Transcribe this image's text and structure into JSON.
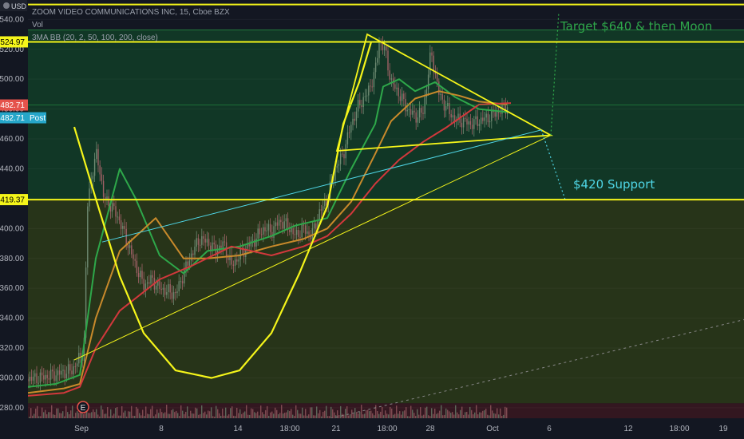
{
  "legend": {
    "symbol": "ZOOM VIDEO COMMUNICATIONS INC, 15, Cboe BZX",
    "volume": "Vol",
    "indicator": "3MA BB (20, 2, 50, 100, 200, close)"
  },
  "axis": {
    "currency": "USD",
    "price_badges": [
      {
        "value": "524.97",
        "color": "#f5f51a"
      },
      {
        "value": "482.71",
        "color": "#e5534b"
      },
      {
        "value": "419.37",
        "color": "#f5f51a"
      }
    ],
    "post_badge": {
      "value": "482.71",
      "label": "Post",
      "color": "#26a6c9"
    }
  },
  "annotations": {
    "target": "Target $640 & then Moon",
    "support": "$420 Support",
    "event_marker": "E"
  },
  "colors": {
    "background": "#131722",
    "upper_zone": "#123d27",
    "lower_zone": "#2c3a18",
    "volume_zone": "#3a1720",
    "yellow": "#f5f51a",
    "cyan": "#4fd6e6",
    "ma_green": "#2ea84a",
    "ma_orange": "#c98a2b",
    "ma_red": "#d2383c",
    "candle_up": "#6e8a72",
    "candle_down": "#a06166",
    "target_text": "#2ea84a",
    "support_text": "#4fd6e6"
  },
  "chart_data": {
    "type": "candlestick",
    "y_ticks": [
      280,
      300,
      320,
      340,
      360,
      380,
      400,
      420,
      440,
      460,
      480,
      500,
      520,
      540
    ],
    "ylim": [
      273,
      553
    ],
    "x_ticks": [
      "Sep",
      "8",
      "14",
      "18:00",
      "21",
      "18:00",
      "28",
      "Oct",
      "6",
      "12",
      "18:00",
      "19"
    ],
    "horizontal_levels": [
      550,
      533,
      524.97,
      482.71,
      419.37
    ],
    "zones": [
      {
        "name": "upper",
        "from": 419.37,
        "to": 533
      },
      {
        "name": "lower",
        "from": 283,
        "to": 419.37
      },
      {
        "name": "volume",
        "from": 273,
        "to": 283
      }
    ],
    "price_path": [
      [
        0,
        298
      ],
      [
        50,
        300
      ],
      [
        90,
        305
      ],
      [
        105,
        318
      ],
      [
        110,
        420
      ],
      [
        120,
        450
      ],
      [
        125,
        440
      ],
      [
        130,
        420
      ],
      [
        140,
        415
      ],
      [
        150,
        405
      ],
      [
        160,
        390
      ],
      [
        170,
        375
      ],
      [
        180,
        362
      ],
      [
        190,
        366
      ],
      [
        200,
        360
      ],
      [
        210,
        358
      ],
      [
        220,
        356
      ],
      [
        230,
        370
      ],
      [
        240,
        383
      ],
      [
        250,
        393
      ],
      [
        260,
        391
      ],
      [
        270,
        385
      ],
      [
        280,
        390
      ],
      [
        290,
        375
      ],
      [
        300,
        382
      ],
      [
        310,
        388
      ],
      [
        320,
        393
      ],
      [
        330,
        400
      ],
      [
        340,
        398
      ],
      [
        350,
        405
      ],
      [
        360,
        402
      ],
      [
        370,
        395
      ],
      [
        380,
        400
      ],
      [
        390,
        395
      ],
      [
        400,
        410
      ],
      [
        410,
        420
      ],
      [
        420,
        440
      ],
      [
        430,
        450
      ],
      [
        440,
        470
      ],
      [
        450,
        483
      ],
      [
        460,
        490
      ],
      [
        470,
        505
      ],
      [
        475,
        525
      ],
      [
        482,
        520
      ],
      [
        490,
        498
      ],
      [
        500,
        490
      ],
      [
        510,
        480
      ],
      [
        520,
        475
      ],
      [
        530,
        478
      ],
      [
        540,
        518
      ],
      [
        550,
        490
      ],
      [
        560,
        480
      ],
      [
        570,
        473
      ],
      [
        580,
        472
      ],
      [
        590,
        470
      ],
      [
        600,
        472
      ],
      [
        610,
        474
      ],
      [
        620,
        477
      ],
      [
        630,
        480
      ],
      [
        637,
        482.7
      ]
    ],
    "ma_series": [
      {
        "color_key": "ma_green",
        "points": [
          [
            35,
            294
          ],
          [
            70,
            296
          ],
          [
            100,
            302
          ],
          [
            120,
            380
          ],
          [
            150,
            440
          ],
          [
            170,
            420
          ],
          [
            200,
            382
          ],
          [
            230,
            370
          ],
          [
            260,
            385
          ],
          [
            300,
            388
          ],
          [
            340,
            395
          ],
          [
            370,
            402
          ],
          [
            410,
            407
          ],
          [
            440,
            440
          ],
          [
            470,
            470
          ],
          [
            480,
            495
          ],
          [
            500,
            500
          ],
          [
            520,
            492
          ],
          [
            545,
            498
          ],
          [
            570,
            488
          ],
          [
            600,
            480
          ],
          [
            635,
            478
          ]
        ]
      },
      {
        "color_key": "ma_orange",
        "points": [
          [
            35,
            290
          ],
          [
            80,
            293
          ],
          [
            100,
            296
          ],
          [
            120,
            340
          ],
          [
            150,
            385
          ],
          [
            195,
            407
          ],
          [
            230,
            380
          ],
          [
            260,
            380
          ],
          [
            300,
            382
          ],
          [
            340,
            388
          ],
          [
            380,
            393
          ],
          [
            410,
            400
          ],
          [
            440,
            418
          ],
          [
            470,
            450
          ],
          [
            490,
            472
          ],
          [
            520,
            487
          ],
          [
            550,
            492
          ],
          [
            575,
            489
          ],
          [
            600,
            485
          ],
          [
            635,
            483
          ]
        ]
      },
      {
        "color_key": "ma_red",
        "points": [
          [
            35,
            288
          ],
          [
            80,
            290
          ],
          [
            100,
            294
          ],
          [
            120,
            320
          ],
          [
            150,
            345
          ],
          [
            200,
            366
          ],
          [
            240,
            375
          ],
          [
            290,
            388
          ],
          [
            340,
            382
          ],
          [
            380,
            388
          ],
          [
            410,
            395
          ],
          [
            440,
            410
          ],
          [
            470,
            430
          ],
          [
            500,
            446
          ],
          [
            530,
            458
          ],
          [
            560,
            468
          ],
          [
            600,
            483
          ],
          [
            640,
            484
          ]
        ]
      }
    ],
    "drawings": {
      "cup_curve": [
        [
          93,
          468
        ],
        [
          120,
          420
        ],
        [
          150,
          368
        ],
        [
          180,
          330
        ],
        [
          220,
          305
        ],
        [
          265,
          300
        ],
        [
          300,
          305
        ],
        [
          340,
          330
        ],
        [
          375,
          370
        ],
        [
          410,
          415
        ],
        [
          430,
          470
        ],
        [
          450,
          498
        ],
        [
          465,
          525
        ]
      ],
      "triangle": [
        [
          422,
          452
        ],
        [
          690,
          462.5
        ],
        [
          460,
          530
        ]
      ],
      "yellow_support_line": [
        [
          93,
          312
        ],
        [
          690,
          462.5
        ]
      ],
      "cyan_channel": [
        [
          128,
          391
        ],
        [
          678,
          466
        ]
      ],
      "target_path": [
        [
          690,
          462.5
        ],
        [
          700,
          545
        ]
      ],
      "support_path": [
        [
          678,
          466
        ],
        [
          708,
          419.37
        ]
      ],
      "bottom_trend": [
        [
          400,
          271
        ],
        [
          932,
          339
        ]
      ]
    },
    "volume_bars": 300
  }
}
